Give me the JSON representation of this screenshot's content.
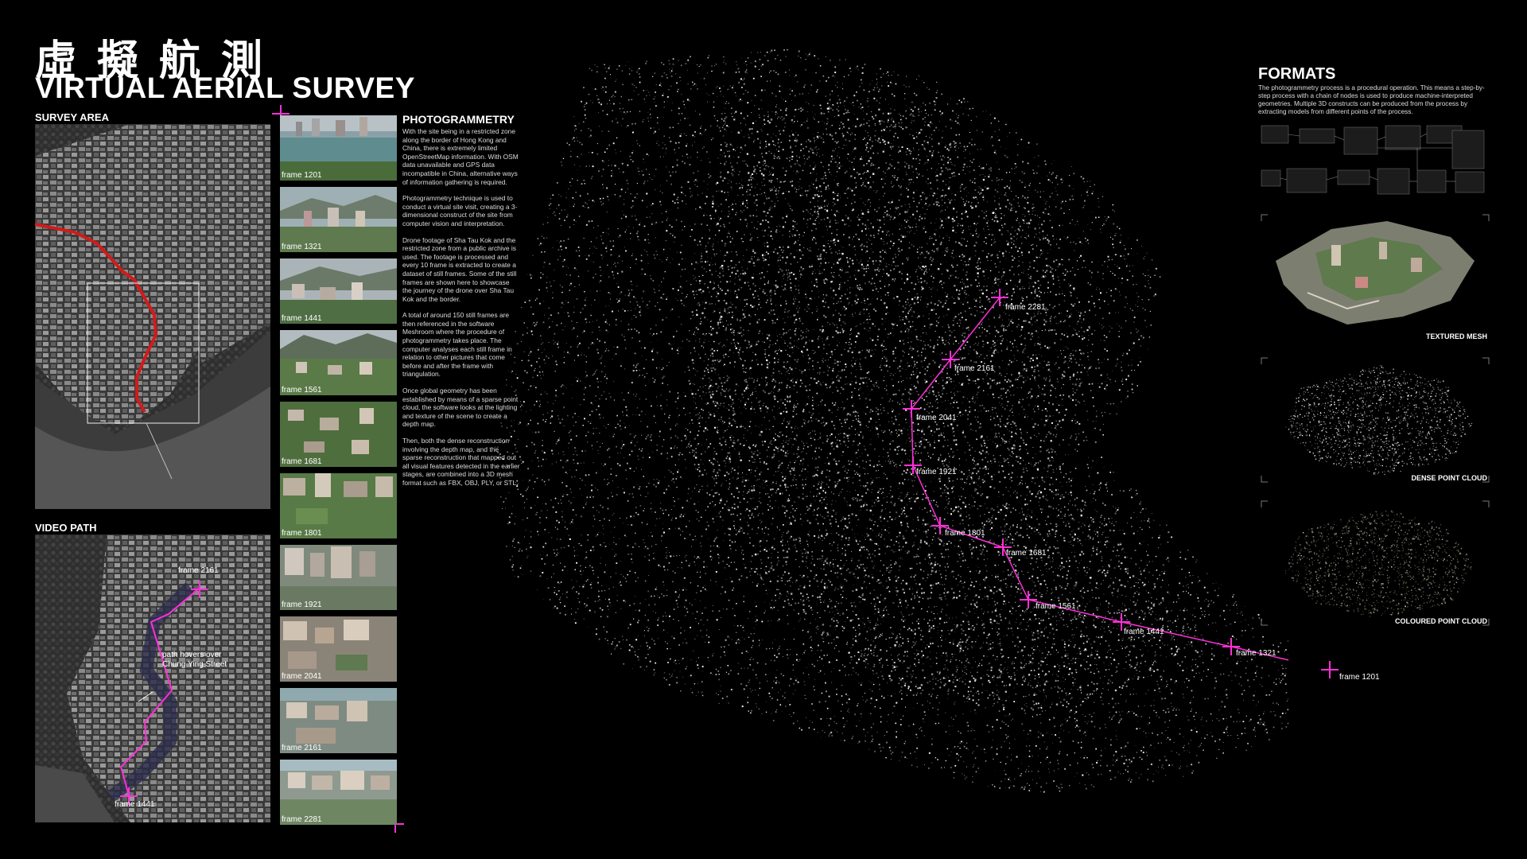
{
  "title": {
    "chinese": "虛擬航測",
    "english": "VIRTUAL AERIAL SURVEY"
  },
  "survey_area": {
    "label": "SURVEY AREA"
  },
  "video_path": {
    "label": "VIDEO PATH",
    "annotation_line1": "path hovers over",
    "annotation_line2": "Chung Ying Street",
    "start_label": "frame 2161",
    "end_label": "frame 1441"
  },
  "frames": [
    {
      "label": "frame 1201"
    },
    {
      "label": "frame 1321"
    },
    {
      "label": "frame 1441"
    },
    {
      "label": "frame 1561"
    },
    {
      "label": "frame 1681"
    },
    {
      "label": "frame 1801"
    },
    {
      "label": "frame 1921"
    },
    {
      "label": "frame 2041"
    },
    {
      "label": "frame 2161"
    },
    {
      "label": "frame 2281"
    }
  ],
  "photogrammetry": {
    "heading": "PHOTOGRAMMETRY",
    "paragraphs": [
      "With the site being in a restricted zone along the border of Hong Kong and China, there is extremely limited OpenStreetMap information. With OSM data unavailable and GPS data incompatible in China, alternative ways of information gathering is required.",
      "Photogrammetry technique is used to conduct a virtual site visit, creating a 3-dimensional construct of the site from computer vision and interpretation.",
      "Drone footage of Sha Tau Kok and the restricted zone from a public archive is used. The footage is processed and every 10 frame is extracted to create a dataset of still frames. Some of the still frames are shown here to showcase the journey of the drone over Sha Tau Kok and the border.",
      "A total of around 150 still frames are then referenced in the software Meshroom where the procedure of photogrammetry takes place. The computer analyses each still frame in relation to other pictures that come before and after the frame with triangulation.",
      "Once global geometry has been established by means of a sparse point cloud, the software looks at the lighting and texture of the scene to create a depth map.",
      "Then, both the dense reconstruction involving the depth map, and the sparse reconstruction that mapped out all visual features detected in the earlier stages, are combined into a 3D mesh format such as FBX, OBJ, PLY, or STL."
    ]
  },
  "cloud_path_labels": [
    "frame 2281",
    "frame 2161",
    "frame 2041",
    "frame 1921",
    "frame 1801",
    "frame 1681",
    "frame 1561",
    "frame 1441",
    "frame 1321",
    "frame 1201"
  ],
  "formats": {
    "heading": "FORMATS",
    "text": "The photogrammetry process is a procedural operation. This means a step-by-step process with a chain of nodes is used to produce machine-interpreted geometries. Multiple 3D constructs can be produced from the process by extracting models from different points of the process.",
    "outputs": [
      {
        "caption": "TEXTURED MESH"
      },
      {
        "caption": "DENSE POINT CLOUD"
      },
      {
        "caption": "COLOURED POINT CLOUD"
      }
    ]
  },
  "colors": {
    "accent": "#ff2fd8",
    "path_red": "#d21a1a",
    "background": "#000000"
  }
}
